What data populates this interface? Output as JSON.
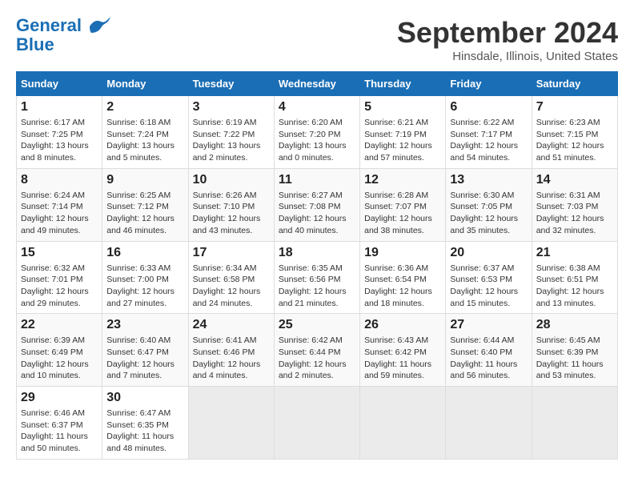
{
  "header": {
    "logo_line1": "General",
    "logo_line2": "Blue",
    "month": "September 2024",
    "location": "Hinsdale, Illinois, United States"
  },
  "columns": [
    "Sunday",
    "Monday",
    "Tuesday",
    "Wednesday",
    "Thursday",
    "Friday",
    "Saturday"
  ],
  "weeks": [
    [
      {
        "day": "1",
        "sunrise": "6:17 AM",
        "sunset": "7:25 PM",
        "daylight": "13 hours and 8 minutes."
      },
      {
        "day": "2",
        "sunrise": "6:18 AM",
        "sunset": "7:24 PM",
        "daylight": "13 hours and 5 minutes."
      },
      {
        "day": "3",
        "sunrise": "6:19 AM",
        "sunset": "7:22 PM",
        "daylight": "13 hours and 2 minutes."
      },
      {
        "day": "4",
        "sunrise": "6:20 AM",
        "sunset": "7:20 PM",
        "daylight": "13 hours and 0 minutes."
      },
      {
        "day": "5",
        "sunrise": "6:21 AM",
        "sunset": "7:19 PM",
        "daylight": "12 hours and 57 minutes."
      },
      {
        "day": "6",
        "sunrise": "6:22 AM",
        "sunset": "7:17 PM",
        "daylight": "12 hours and 54 minutes."
      },
      {
        "day": "7",
        "sunrise": "6:23 AM",
        "sunset": "7:15 PM",
        "daylight": "12 hours and 51 minutes."
      }
    ],
    [
      {
        "day": "8",
        "sunrise": "6:24 AM",
        "sunset": "7:14 PM",
        "daylight": "12 hours and 49 minutes."
      },
      {
        "day": "9",
        "sunrise": "6:25 AM",
        "sunset": "7:12 PM",
        "daylight": "12 hours and 46 minutes."
      },
      {
        "day": "10",
        "sunrise": "6:26 AM",
        "sunset": "7:10 PM",
        "daylight": "12 hours and 43 minutes."
      },
      {
        "day": "11",
        "sunrise": "6:27 AM",
        "sunset": "7:08 PM",
        "daylight": "12 hours and 40 minutes."
      },
      {
        "day": "12",
        "sunrise": "6:28 AM",
        "sunset": "7:07 PM",
        "daylight": "12 hours and 38 minutes."
      },
      {
        "day": "13",
        "sunrise": "6:30 AM",
        "sunset": "7:05 PM",
        "daylight": "12 hours and 35 minutes."
      },
      {
        "day": "14",
        "sunrise": "6:31 AM",
        "sunset": "7:03 PM",
        "daylight": "12 hours and 32 minutes."
      }
    ],
    [
      {
        "day": "15",
        "sunrise": "6:32 AM",
        "sunset": "7:01 PM",
        "daylight": "12 hours and 29 minutes."
      },
      {
        "day": "16",
        "sunrise": "6:33 AM",
        "sunset": "7:00 PM",
        "daylight": "12 hours and 27 minutes."
      },
      {
        "day": "17",
        "sunrise": "6:34 AM",
        "sunset": "6:58 PM",
        "daylight": "12 hours and 24 minutes."
      },
      {
        "day": "18",
        "sunrise": "6:35 AM",
        "sunset": "6:56 PM",
        "daylight": "12 hours and 21 minutes."
      },
      {
        "day": "19",
        "sunrise": "6:36 AM",
        "sunset": "6:54 PM",
        "daylight": "12 hours and 18 minutes."
      },
      {
        "day": "20",
        "sunrise": "6:37 AM",
        "sunset": "6:53 PM",
        "daylight": "12 hours and 15 minutes."
      },
      {
        "day": "21",
        "sunrise": "6:38 AM",
        "sunset": "6:51 PM",
        "daylight": "12 hours and 13 minutes."
      }
    ],
    [
      {
        "day": "22",
        "sunrise": "6:39 AM",
        "sunset": "6:49 PM",
        "daylight": "12 hours and 10 minutes."
      },
      {
        "day": "23",
        "sunrise": "6:40 AM",
        "sunset": "6:47 PM",
        "daylight": "12 hours and 7 minutes."
      },
      {
        "day": "24",
        "sunrise": "6:41 AM",
        "sunset": "6:46 PM",
        "daylight": "12 hours and 4 minutes."
      },
      {
        "day": "25",
        "sunrise": "6:42 AM",
        "sunset": "6:44 PM",
        "daylight": "12 hours and 2 minutes."
      },
      {
        "day": "26",
        "sunrise": "6:43 AM",
        "sunset": "6:42 PM",
        "daylight": "11 hours and 59 minutes."
      },
      {
        "day": "27",
        "sunrise": "6:44 AM",
        "sunset": "6:40 PM",
        "daylight": "11 hours and 56 minutes."
      },
      {
        "day": "28",
        "sunrise": "6:45 AM",
        "sunset": "6:39 PM",
        "daylight": "11 hours and 53 minutes."
      }
    ],
    [
      {
        "day": "29",
        "sunrise": "6:46 AM",
        "sunset": "6:37 PM",
        "daylight": "11 hours and 50 minutes."
      },
      {
        "day": "30",
        "sunrise": "6:47 AM",
        "sunset": "6:35 PM",
        "daylight": "11 hours and 48 minutes."
      },
      null,
      null,
      null,
      null,
      null
    ]
  ]
}
